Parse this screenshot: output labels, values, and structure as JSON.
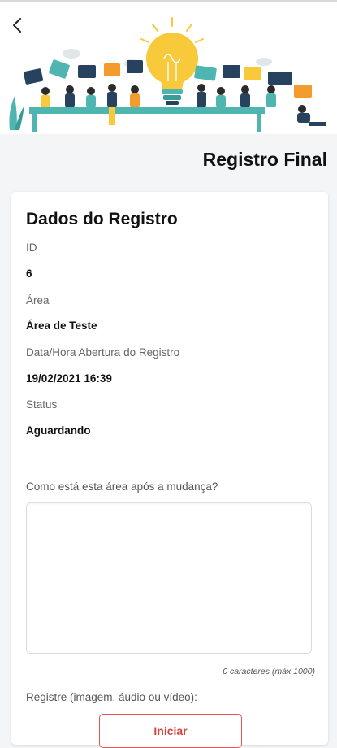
{
  "header": {
    "back_icon": "chevron-left-icon",
    "title": "Registro Final"
  },
  "colors": {
    "accent": "#d8433c",
    "bulb": "#f9c93c",
    "bubble_dark": "#27425e",
    "bubble_teal": "#4fb5b0",
    "bubble_orange": "#f39b2d"
  },
  "details": {
    "heading": "Dados do Registro",
    "fields": [
      {
        "label": "ID",
        "value": "6"
      },
      {
        "label": "Área",
        "value": "Área de Teste"
      },
      {
        "label": "Data/Hora Abertura do Registro",
        "value": "19/02/2021 16:39"
      },
      {
        "label": "Status",
        "value": "Aguardando"
      }
    ]
  },
  "form": {
    "question": "Como está esta área após a mudança?",
    "answer": "",
    "counter": "0 caracteres (máx 1000)",
    "media_label": "Registre (imagem, áudio ou vídeo):",
    "start_button": "Iniciar"
  }
}
